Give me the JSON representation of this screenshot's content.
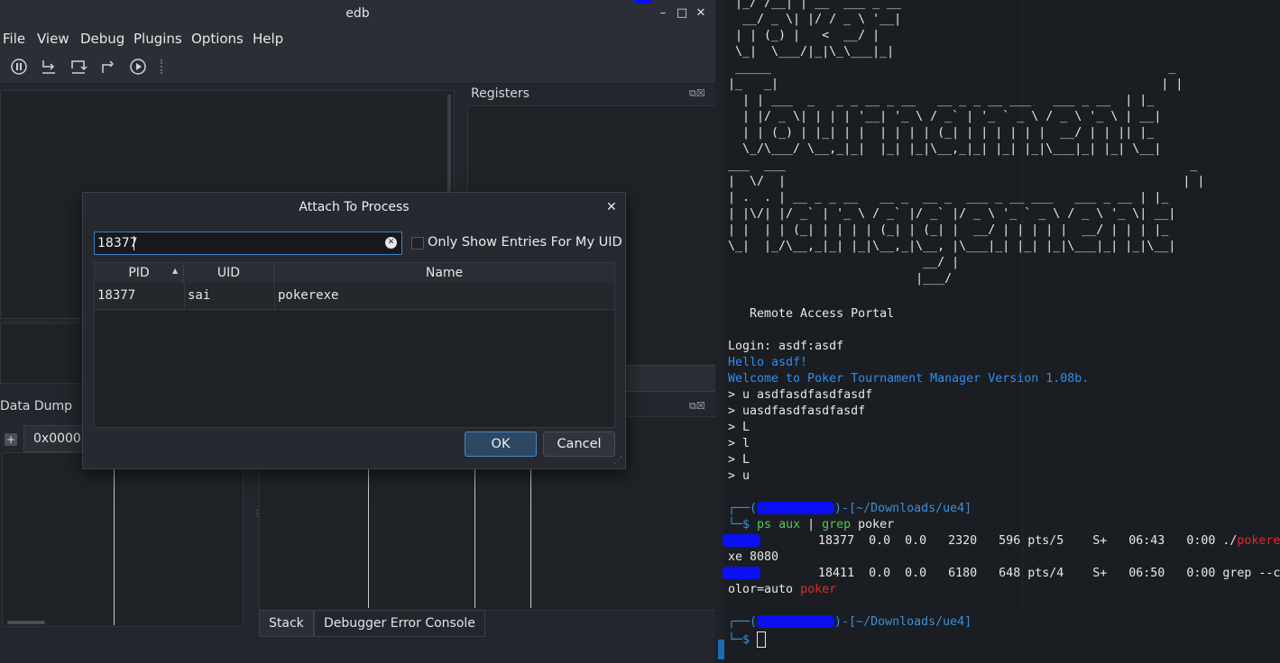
{
  "edb": {
    "title": "edb",
    "menus": [
      "File",
      "View",
      "Debug",
      "Plugins",
      "Options",
      "Help"
    ],
    "registers_label": "Registers",
    "data_dump_label": "Data Dump",
    "address_tab": "0x0000",
    "bottom_tabs": [
      "Stack",
      "Debugger Error Console"
    ]
  },
  "dialog": {
    "title": "Attach To Process",
    "search_value": "18377",
    "filter_label": "Only Show Entries For My UID",
    "columns": [
      "PID",
      "UID",
      "Name"
    ],
    "rows": [
      {
        "pid": "18377",
        "uid": "sai",
        "name": "pokerexe"
      }
    ],
    "ok_label": "OK",
    "cancel_label": "Cancel"
  },
  "terminal": {
    "banner": [
      " |_/ /__| | __  ___ _ __",
      "  __/ _ \\| |/ / _ \\ '__|",
      " | | (_) |   <  __/ |",
      " \\_|  \\___/|_|\\_\\___|_|",
      " _____                                                       _",
      "|_   _|                                                     | |",
      "  | | ___  _   _ _ __ _ __   __ _ _ __ ___   ___ _ __  | |_",
      "  | |/ _ \\| | | | '__| '_ \\ / _` | '_ ` _ \\ / _ \\ '_ \\ | __|",
      "  | | (_) | |_| | |  | | | | (_| | | | | | |  __/ | | || |_",
      "  \\_/\\___/ \\__,_|_|  |_| |_|\\__,_|_| |_| |_|\\___|_| |_| \\__|",
      "___  ___                                                        _",
      "|  \\/  |                                                       | |",
      "| .  . | __ _ _ __   __ _  __ _  ___ _ __ ___   ___ _ __ | |_",
      "| |\\/| |/ _` | '_ \\ / _` |/ _` |/ _ \\ '_ ` _ \\ / _ \\ '_ \\| __|",
      "| |  | | (_| | | | | (_| | (_| |  __/ | | | | |  __/ | | | |_",
      "\\_|  |_/\\__,_|_| |_|\\__,_|\\__, |\\___|_| |_| |_|\\___|_| |_|\\__|",
      "                           __/ |",
      "                          |___/"
    ],
    "portal": "   Remote Access Portal",
    "login": "Login: asdf:asdf",
    "hello": "Hello asdf!",
    "welcome": "Welcome to Poker Tournament Manager Version 1.08b.",
    "cmds": [
      "> u asdfasdfasdfasdf",
      "> uasdfasdfasdfasdf",
      "> L",
      "> l",
      "> L",
      "> u"
    ],
    "prompt_path": "-[~/Downloads/ue4]",
    "command_ps": "ps aux",
    "command_pipe": " | ",
    "command_grep": "grep",
    "command_arg": " poker",
    "ps1_a": "        18377  0.0  0.0   2320   596 pts/5    S+   06:43   0:00 ./",
    "ps1_red": "pokere",
    "ps1_b": "xe 8080",
    "ps2_a": "        18411  0.0  0.0   6180   648 pts/4    S+   06:50   0:00 grep --c",
    "ps2_b": "olor=auto ",
    "ps2_red": "poker",
    "dollar": "$"
  }
}
